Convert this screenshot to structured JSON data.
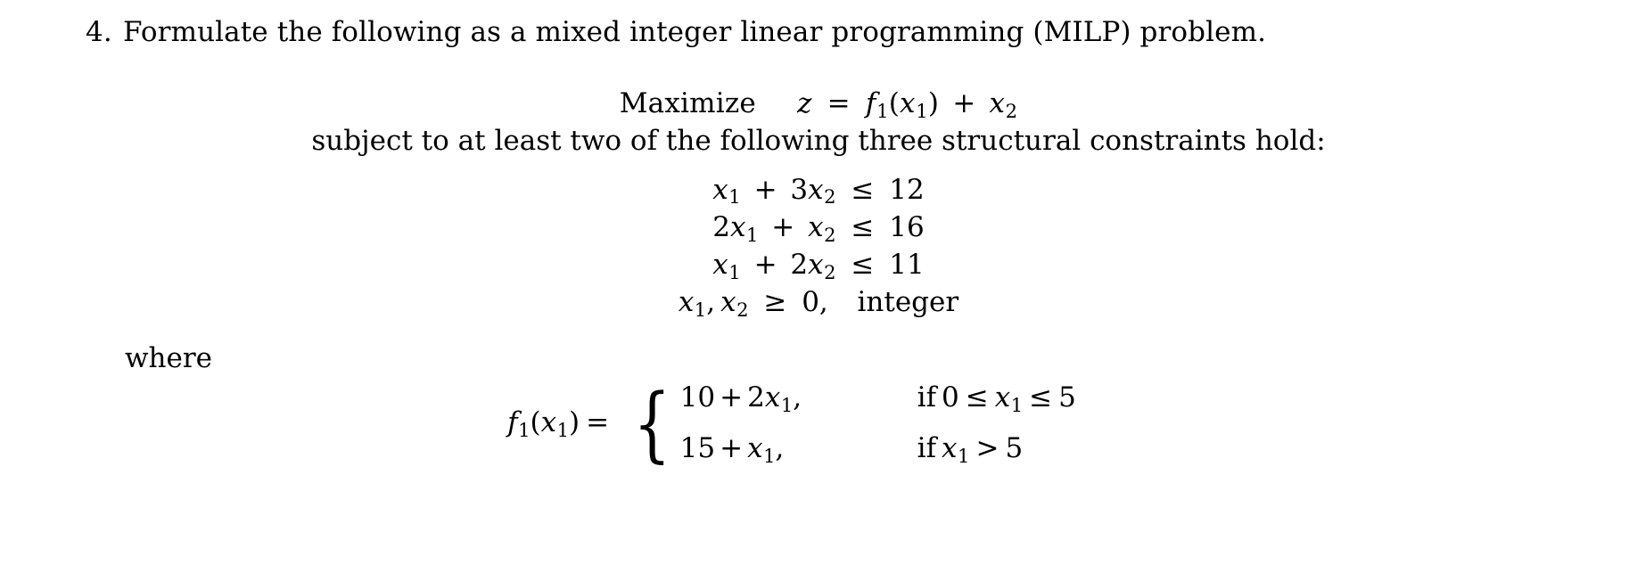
{
  "document": {
    "problem_number": "4.",
    "problem_statement": "Formulate the following as a mixed integer linear programming (MILP) problem.",
    "where_label": "where"
  },
  "math": {
    "objective": {
      "keyword": "Maximize",
      "var": "z",
      "equals": "=",
      "fn_name": "f",
      "fn_sub": "1",
      "fn_arg_open": "(",
      "fn_arg": "x",
      "fn_arg_sub": "1",
      "fn_arg_close": ")",
      "plus": "+",
      "term2": "x",
      "term2_sub": "2"
    },
    "subject_to_text": "subject to at least two of the following three structural constraints hold:",
    "constraints": [
      {
        "lhs_coef1": "",
        "lhs_var1": "x",
        "lhs_sub1": "1",
        "op": "+",
        "lhs_coef2": "3",
        "lhs_var2": "x",
        "lhs_sub2": "2",
        "rel": "≤",
        "rhs": "12"
      },
      {
        "lhs_coef1": "2",
        "lhs_var1": "x",
        "lhs_sub1": "1",
        "op": "+",
        "lhs_coef2": "",
        "lhs_var2": "x",
        "lhs_sub2": "2",
        "rel": "≤",
        "rhs": "16"
      },
      {
        "lhs_coef1": "",
        "lhs_var1": "x",
        "lhs_sub1": "1",
        "op": "+",
        "lhs_coef2": "2",
        "lhs_var2": "x",
        "lhs_sub2": "2",
        "rel": "≤",
        "rhs": "11"
      }
    ],
    "nonnegativity": {
      "var1": "x",
      "sub1": "1",
      "comma": ",",
      "var2": "x",
      "sub2": "2",
      "rel": "≥",
      "rhs": "0,",
      "integer_word": "integer"
    },
    "piecewise": {
      "fn_name": "f",
      "fn_sub": "1",
      "arg_open": "(",
      "arg": "x",
      "arg_sub": "1",
      "arg_close": ")",
      "equals": "=",
      "cases": [
        {
          "expr_const": "10",
          "expr_op": "+",
          "expr_coef": "2",
          "expr_var": "x",
          "expr_sub": "1",
          "expr_trail": ",",
          "cond_if": "if",
          "cond_lo": "0",
          "cond_rel1": "≤",
          "cond_var": "x",
          "cond_sub": "1",
          "cond_rel2": "≤",
          "cond_hi": "5"
        },
        {
          "expr_const": "15",
          "expr_op": "+",
          "expr_coef": "",
          "expr_var": "x",
          "expr_sub": "1",
          "expr_trail": ",",
          "cond_if": "if",
          "cond_lo": "",
          "cond_rel1": "",
          "cond_var": "x",
          "cond_sub": "1",
          "cond_rel2": ">",
          "cond_hi": "5"
        }
      ]
    }
  },
  "colors": {
    "page_background": "#ffffff",
    "text": "#000000"
  }
}
